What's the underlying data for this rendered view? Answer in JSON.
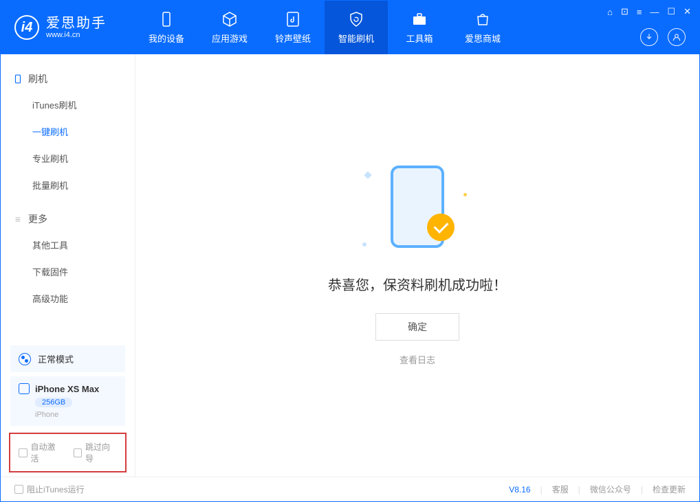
{
  "logo": {
    "title": "爱思助手",
    "url": "www.i4.cn"
  },
  "nav": [
    {
      "label": "我的设备"
    },
    {
      "label": "应用游戏"
    },
    {
      "label": "铃声壁纸"
    },
    {
      "label": "智能刷机"
    },
    {
      "label": "工具箱"
    },
    {
      "label": "爱思商城"
    }
  ],
  "sidebar": {
    "section1": {
      "title": "刷机",
      "items": [
        "iTunes刷机",
        "一键刷机",
        "专业刷机",
        "批量刷机"
      ]
    },
    "section2": {
      "title": "更多",
      "items": [
        "其他工具",
        "下载固件",
        "高级功能"
      ]
    }
  },
  "mode": {
    "label": "正常模式"
  },
  "device": {
    "name": "iPhone XS Max",
    "capacity": "256GB",
    "type": "iPhone"
  },
  "options": {
    "auto_activate": "自动激活",
    "skip_guide": "跳过向导"
  },
  "main": {
    "success_text": "恭喜您，保资料刷机成功啦！",
    "ok_button": "确定",
    "view_log": "查看日志"
  },
  "footer": {
    "block_itunes": "阻止iTunes运行",
    "version": "V8.16",
    "links": [
      "客服",
      "微信公众号",
      "检查更新"
    ]
  }
}
